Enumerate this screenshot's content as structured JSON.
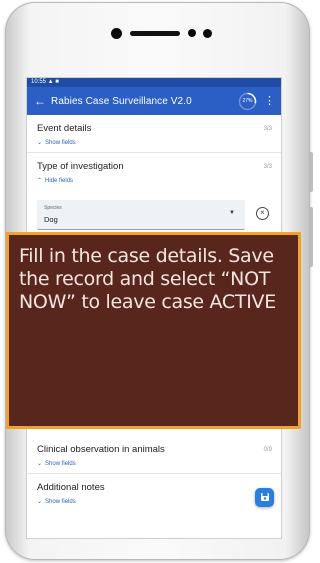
{
  "status_bar": {
    "text": "10:55 ▲ ■"
  },
  "app_bar": {
    "title": "Rabies Case Surveillance V2.0",
    "progress": "27%",
    "back_icon": "back-arrow-icon",
    "menu_icon": "more-vert-icon"
  },
  "sections": [
    {
      "title": "Event details",
      "count": "3/3",
      "toggle": "Show fields",
      "toggle_icon": "chevron-down-icon"
    },
    {
      "title": "Type of investigation",
      "count": "3/3",
      "toggle": "Hide fields",
      "toggle_icon": "chevron-up-icon"
    }
  ],
  "species_field": {
    "label": "Species",
    "value": "Dog"
  },
  "lower_sections": [
    {
      "title": "Clinical observation in animals",
      "count": "0/9",
      "toggle": "Show fields"
    },
    {
      "title": "Additional notes",
      "count": "",
      "toggle": "Show fields"
    }
  ],
  "overlay": {
    "text": "Fill in the case details. Save the record and select “NOT NOW” to leave case ACTIVE"
  },
  "colors": {
    "app_bar": "#2b5fc4",
    "status_bar": "#1f4da6",
    "overlay_bg": "#59261d",
    "overlay_border": "#f0a22a",
    "fab": "#2b7de0"
  }
}
